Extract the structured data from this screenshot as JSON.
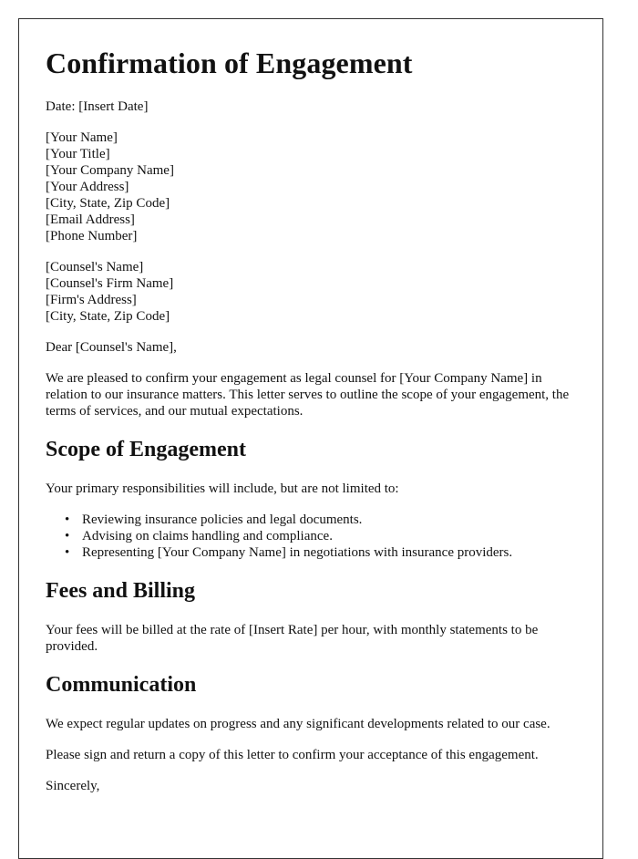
{
  "title": "Confirmation of Engagement",
  "date_line": "Date: [Insert Date]",
  "sender": [
    "[Your Name]",
    "[Your Title]",
    "[Your Company Name]",
    "[Your Address]",
    "[City, State, Zip Code]",
    "[Email Address]",
    "[Phone Number]"
  ],
  "recipient": [
    "[Counsel's Name]",
    "[Counsel's Firm Name]",
    "[Firm's Address]",
    "[City, State, Zip Code]"
  ],
  "salutation": "Dear [Counsel's Name],",
  "intro": "We are pleased to confirm your engagement as legal counsel for [Your Company Name] in relation to our insurance matters. This letter serves to outline the scope of your engagement, the terms of services, and our mutual expectations.",
  "scope": {
    "heading": "Scope of Engagement",
    "intro": "Your primary responsibilities will include, but are not limited to:",
    "bullet_glyph": "•",
    "items": [
      "Reviewing insurance policies and legal documents.",
      "Advising on claims handling and compliance.",
      "Representing [Your Company Name] in negotiations with insurance providers."
    ]
  },
  "fees": {
    "heading": "Fees and Billing",
    "text": "Your fees will be billed at the rate of [Insert Rate] per hour, with monthly statements to be provided."
  },
  "communication": {
    "heading": "Communication",
    "text": "We expect regular updates on progress and any significant developments related to our case."
  },
  "closing_request": "Please sign and return a copy of this letter to confirm your acceptance of this engagement.",
  "closing": "Sincerely,"
}
